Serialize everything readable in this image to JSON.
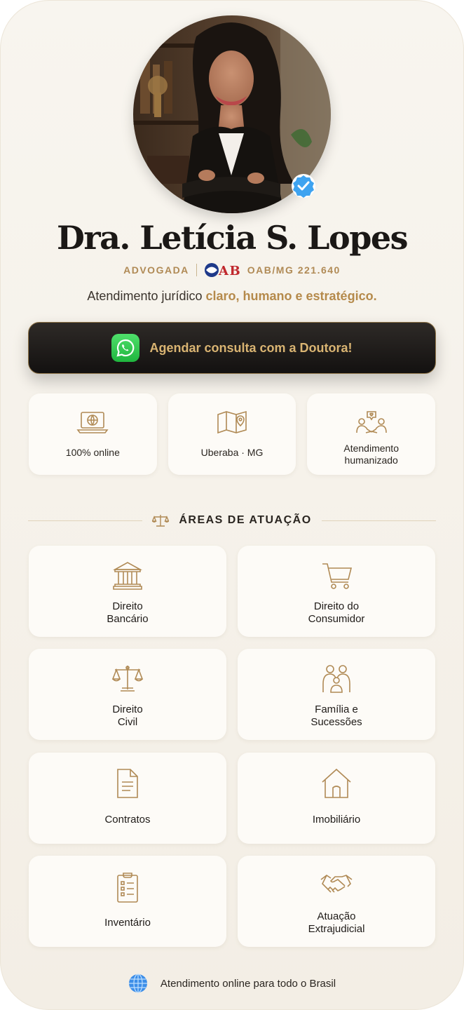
{
  "profile": {
    "name": "Dra. Letícia S. Lopes",
    "role": "ADVOGADA",
    "oab_logo": "OAB",
    "oab_number": "OAB/MG 221.640",
    "avatar_alt": "Foto da Dra. Letícia S. Lopes",
    "verified_icon": "verified-check-icon"
  },
  "tagline": {
    "prefix": "Atendimento jurídico ",
    "highlight": "claro, humano e estratégico."
  },
  "cta": {
    "label": "Agendar consulta com a Doutora!",
    "icon": "whatsapp-icon"
  },
  "features": [
    {
      "label": "100% online",
      "icon": "laptop-globe-icon"
    },
    {
      "label": "Uberaba · MG",
      "icon": "map-pin-icon"
    },
    {
      "label_line1": "Atendimento",
      "label_line2": "humanizado",
      "icon": "people-heart-icon"
    }
  ],
  "areas_section": {
    "title": "ÁREAS DE ATUAÇÃO",
    "icon": "scales-icon"
  },
  "areas": [
    {
      "line1": "Direito",
      "line2": "Bancário",
      "icon": "bank-icon"
    },
    {
      "line1": "Direito do",
      "line2": "Consumidor",
      "icon": "cart-icon"
    },
    {
      "line1": "Direito",
      "line2": "Civil",
      "icon": "scales-icon"
    },
    {
      "line1": "Família e",
      "line2": "Sucessões",
      "icon": "family-icon"
    },
    {
      "line1": "Contratos",
      "icon": "document-icon"
    },
    {
      "line1": "Imobiliário",
      "icon": "house-icon"
    },
    {
      "line1": "Inventário",
      "icon": "checklist-icon"
    },
    {
      "line1": "Atuação",
      "line2": "Extrajudicial",
      "icon": "handshake-icon"
    }
  ],
  "footer": {
    "label": "Atendimento online para todo o Brasil",
    "icon": "globe-icon"
  },
  "colors": {
    "gold": "#b08a55",
    "dark": "#1b1816",
    "background": "#f6f2ea",
    "whatsapp": "#25d366"
  }
}
